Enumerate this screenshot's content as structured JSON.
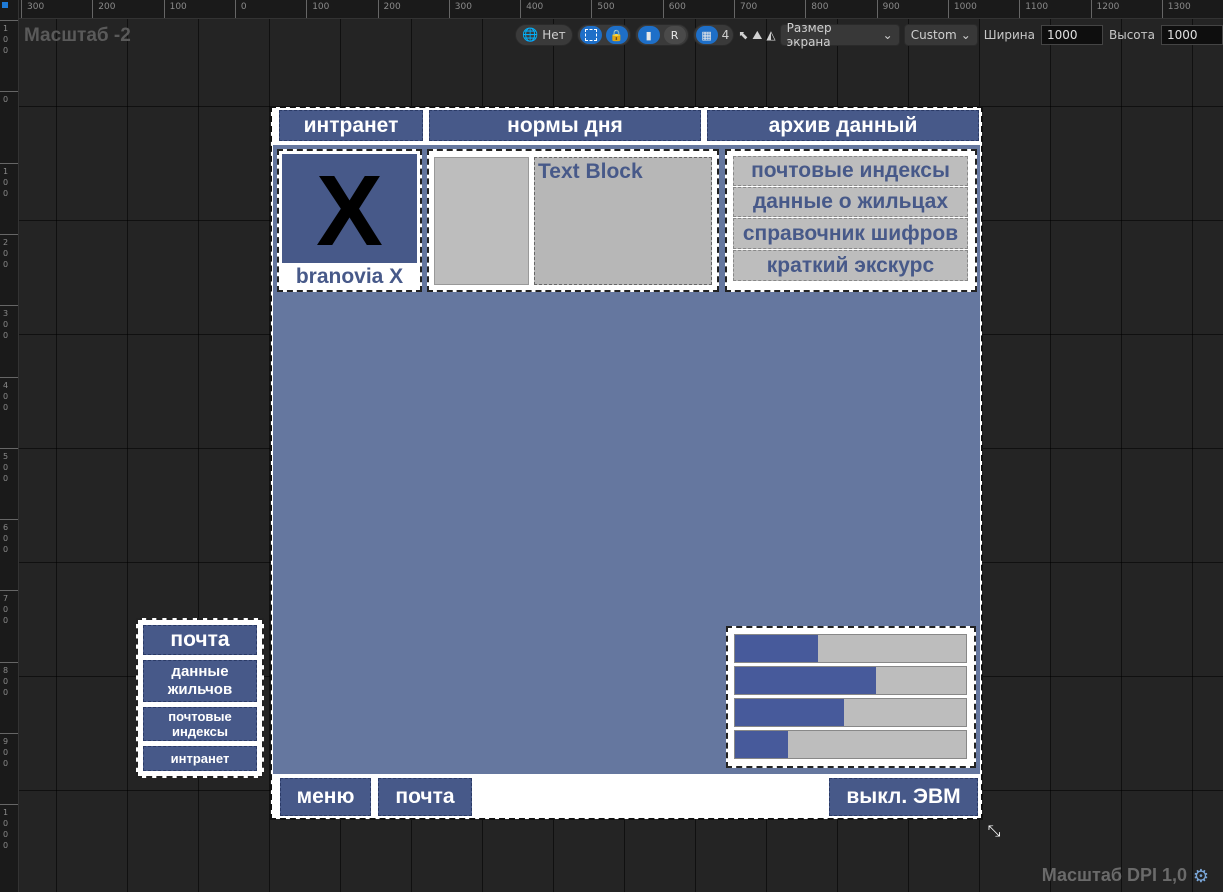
{
  "editor": {
    "zoom_label": "Масштаб -2",
    "dpi_label": "Масштаб DPI 1,0",
    "ruler_x": [
      "300",
      "200",
      "100",
      "0",
      "100",
      "200",
      "300",
      "400",
      "500",
      "600",
      "700",
      "800",
      "900",
      "1000",
      "1100",
      "1200",
      "1300"
    ],
    "ruler_y": [
      "100",
      "0",
      "100",
      "200",
      "300",
      "400",
      "500",
      "600",
      "700",
      "800",
      "900",
      "1000"
    ]
  },
  "toolbar": {
    "localization_label": "Нет",
    "respect_lock_label": "R",
    "grid_snap_value": "4",
    "screen_size_label": "Размер экрана",
    "size_preset_label": "Custom",
    "width_label": "Ширина",
    "width_value": "1000",
    "height_label": "Высота",
    "height_value": "1000"
  },
  "top_nav": [
    "интранет",
    "нормы дня",
    "архив данный"
  ],
  "logo": {
    "letter": "X",
    "caption": "branovia X"
  },
  "text_block": "Text Block",
  "quick_links": [
    "почтовые индексы",
    "данные о жильцах",
    "справочник шифров",
    "краткий экскурс"
  ],
  "side_menu": [
    "почта",
    "данные жильчов",
    "почтовые индексы",
    "интранет"
  ],
  "progress": [
    0.36,
    0.61,
    0.47,
    0.23
  ],
  "bottom_bar": {
    "menu": "меню",
    "mail": "почта",
    "shutdown": "выкл. ЭВМ"
  },
  "colors": {
    "nav_blue": "#475989",
    "main_bg": "#65779f",
    "bar_fill": "#475a9b"
  }
}
